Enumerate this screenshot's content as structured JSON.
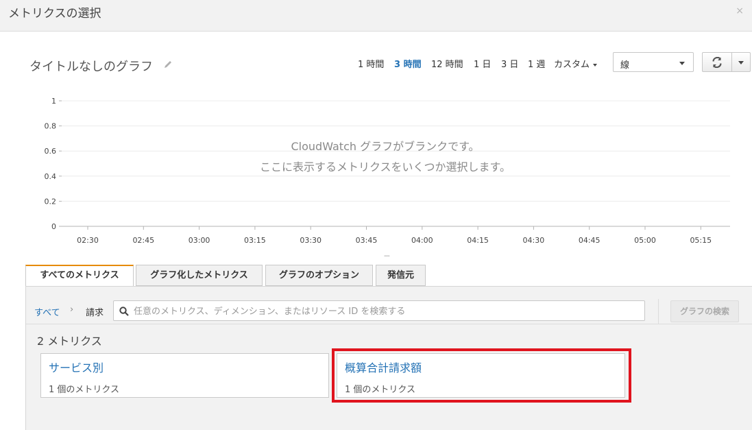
{
  "dialog": {
    "title": "メトリクスの選択",
    "close_icon": "×"
  },
  "graph": {
    "title": "タイトルなしのグラフ",
    "edit_icon": "pencil-icon"
  },
  "time_ranges": [
    {
      "label": "1 時間",
      "active": false
    },
    {
      "label": "3 時間",
      "active": true
    },
    {
      "label": "12 時間",
      "active": false
    },
    {
      "label": "1 日",
      "active": false
    },
    {
      "label": "3 日",
      "active": false
    },
    {
      "label": "1 週",
      "active": false
    }
  ],
  "custom_label": "カスタム",
  "graph_type": {
    "selected": "線"
  },
  "refresh": {
    "icon": "refresh-icon"
  },
  "chart_data": {
    "type": "line",
    "x_ticks": [
      "02:30",
      "02:45",
      "03:00",
      "03:15",
      "03:30",
      "03:45",
      "04:00",
      "04:15",
      "04:30",
      "04:45",
      "05:00",
      "05:15"
    ],
    "y_ticks": [
      "0",
      "0.2",
      "0.4",
      "0.6",
      "0.8",
      "1"
    ],
    "ylim": [
      0,
      1
    ],
    "series": [],
    "grid": true,
    "empty_message": [
      "CloudWatch グラフがブランクです。",
      "ここに表示するメトリクスをいくつか選択します。"
    ]
  },
  "resize_handle": "---",
  "tabs": [
    {
      "label": "すべてのメトリクス",
      "active": true
    },
    {
      "label": "グラフ化したメトリクス",
      "active": false
    },
    {
      "label": "グラフのオプション",
      "active": false
    },
    {
      "label": "発信元",
      "active": false
    }
  ],
  "breadcrumb": {
    "root": "すべて",
    "separator": "›",
    "current": "請求"
  },
  "search": {
    "placeholder": "任意のメトリクス、ディメンション、またはリソース ID を検索する",
    "button": "グラフの検索"
  },
  "metrics_count": "2 メトリクス",
  "namespaces": [
    {
      "name": "サービス別",
      "count": "1 個のメトリクス"
    },
    {
      "name": "概算合計請求額",
      "count": "1 個のメトリクス"
    }
  ],
  "highlight_color": "#e0141e",
  "accent_color": "#2472b5"
}
